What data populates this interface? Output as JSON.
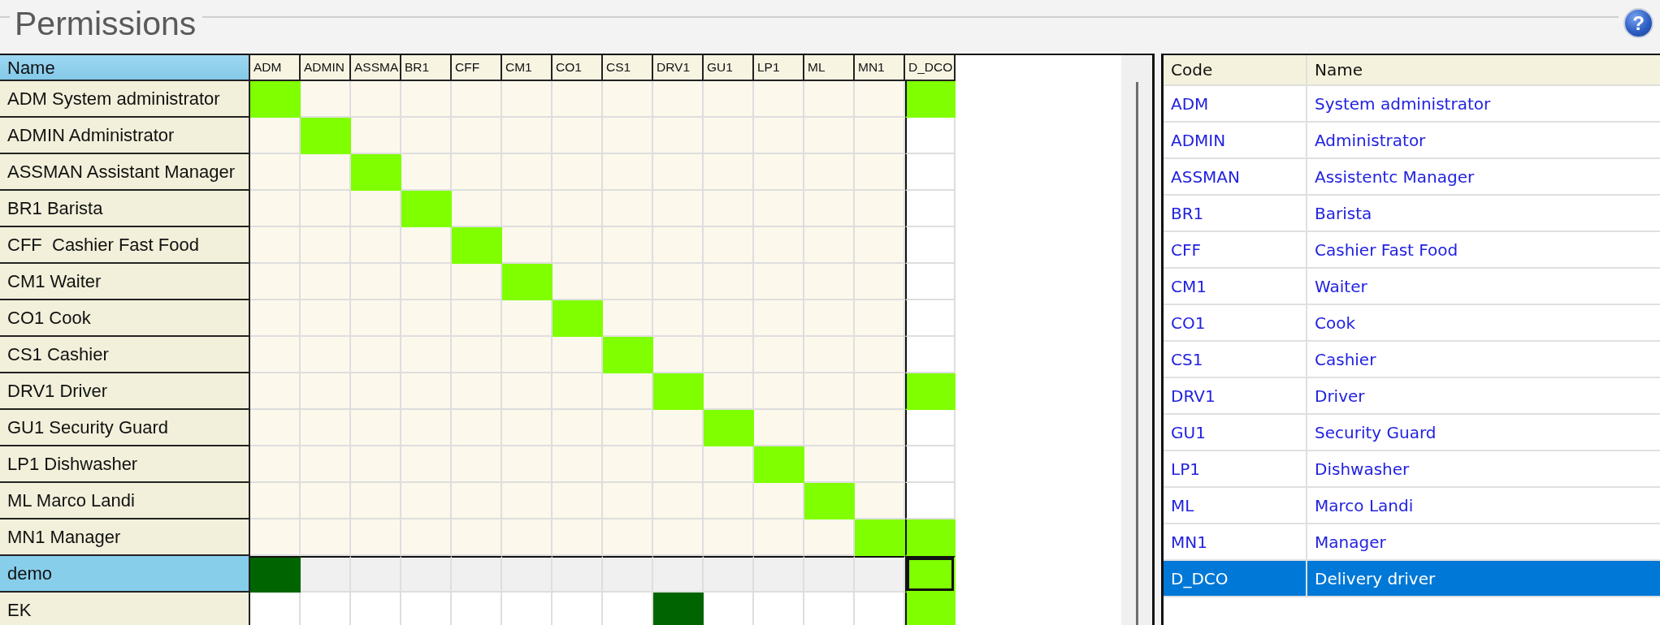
{
  "title": "Permissions",
  "help_button": {
    "label": "?"
  },
  "matrix": {
    "name_header": "Name",
    "columns": [
      {
        "label": "ADM",
        "selected": false
      },
      {
        "label": "ADMIN",
        "selected": false
      },
      {
        "label": "ASSMA",
        "selected": false
      },
      {
        "label": "BR1",
        "selected": false
      },
      {
        "label": "CFF",
        "selected": false
      },
      {
        "label": "CM1",
        "selected": false
      },
      {
        "label": "CO1",
        "selected": false
      },
      {
        "label": "CS1",
        "selected": false
      },
      {
        "label": "DRV1",
        "selected": false
      },
      {
        "label": "GU1",
        "selected": false
      },
      {
        "label": "LP1",
        "selected": false
      },
      {
        "label": "ML",
        "selected": false
      },
      {
        "label": "MN1",
        "selected": false
      },
      {
        "label": "D_DCO",
        "selected": true
      }
    ],
    "rows": [
      {
        "label": "ADM System administrator",
        "kind": "role",
        "selected": false,
        "cells": [
          {
            "checked": true
          },
          {
            "checked": false
          },
          {
            "checked": false
          },
          {
            "checked": false
          },
          {
            "checked": false
          },
          {
            "checked": false
          },
          {
            "checked": false
          },
          {
            "checked": false
          },
          {
            "checked": false
          },
          {
            "checked": false
          },
          {
            "checked": false
          },
          {
            "checked": false
          },
          {
            "checked": false
          },
          {
            "checked": true
          }
        ]
      },
      {
        "label": "ADMIN Administrator",
        "kind": "role",
        "selected": false,
        "cells": [
          {
            "checked": false
          },
          {
            "checked": true
          },
          {
            "checked": false
          },
          {
            "checked": false
          },
          {
            "checked": false
          },
          {
            "checked": false
          },
          {
            "checked": false
          },
          {
            "checked": false
          },
          {
            "checked": false
          },
          {
            "checked": false
          },
          {
            "checked": false
          },
          {
            "checked": false
          },
          {
            "checked": false
          },
          {
            "checked": false
          }
        ]
      },
      {
        "label": "ASSMAN Assistant Manager",
        "kind": "role",
        "selected": false,
        "cells": [
          {
            "checked": false
          },
          {
            "checked": false
          },
          {
            "checked": true
          },
          {
            "checked": false
          },
          {
            "checked": false
          },
          {
            "checked": false
          },
          {
            "checked": false
          },
          {
            "checked": false
          },
          {
            "checked": false
          },
          {
            "checked": false
          },
          {
            "checked": false
          },
          {
            "checked": false
          },
          {
            "checked": false
          },
          {
            "checked": false
          }
        ]
      },
      {
        "label": "BR1 Barista",
        "kind": "role",
        "selected": false,
        "cells": [
          {
            "checked": false
          },
          {
            "checked": false
          },
          {
            "checked": false
          },
          {
            "checked": true
          },
          {
            "checked": false
          },
          {
            "checked": false
          },
          {
            "checked": false
          },
          {
            "checked": false
          },
          {
            "checked": false
          },
          {
            "checked": false
          },
          {
            "checked": false
          },
          {
            "checked": false
          },
          {
            "checked": false
          },
          {
            "checked": false
          }
        ]
      },
      {
        "label": "CFF  Cashier Fast Food",
        "kind": "role",
        "selected": false,
        "cells": [
          {
            "checked": false
          },
          {
            "checked": false
          },
          {
            "checked": false
          },
          {
            "checked": false
          },
          {
            "checked": true
          },
          {
            "checked": false
          },
          {
            "checked": false
          },
          {
            "checked": false
          },
          {
            "checked": false
          },
          {
            "checked": false
          },
          {
            "checked": false
          },
          {
            "checked": false
          },
          {
            "checked": false
          },
          {
            "checked": false
          }
        ]
      },
      {
        "label": "CM1 Waiter",
        "kind": "role",
        "selected": false,
        "cells": [
          {
            "checked": false
          },
          {
            "checked": false
          },
          {
            "checked": false
          },
          {
            "checked": false
          },
          {
            "checked": false
          },
          {
            "checked": true
          },
          {
            "checked": false
          },
          {
            "checked": false
          },
          {
            "checked": false
          },
          {
            "checked": false
          },
          {
            "checked": false
          },
          {
            "checked": false
          },
          {
            "checked": false
          },
          {
            "checked": false
          }
        ]
      },
      {
        "label": "CO1 Cook",
        "kind": "role",
        "selected": false,
        "cells": [
          {
            "checked": false
          },
          {
            "checked": false
          },
          {
            "checked": false
          },
          {
            "checked": false
          },
          {
            "checked": false
          },
          {
            "checked": false
          },
          {
            "checked": true
          },
          {
            "checked": false
          },
          {
            "checked": false
          },
          {
            "checked": false
          },
          {
            "checked": false
          },
          {
            "checked": false
          },
          {
            "checked": false
          },
          {
            "checked": false
          }
        ]
      },
      {
        "label": "CS1 Cashier",
        "kind": "role",
        "selected": false,
        "cells": [
          {
            "checked": false
          },
          {
            "checked": false
          },
          {
            "checked": false
          },
          {
            "checked": false
          },
          {
            "checked": false
          },
          {
            "checked": false
          },
          {
            "checked": false
          },
          {
            "checked": true
          },
          {
            "checked": false
          },
          {
            "checked": false
          },
          {
            "checked": false
          },
          {
            "checked": false
          },
          {
            "checked": false
          },
          {
            "checked": false
          }
        ]
      },
      {
        "label": "DRV1 Driver",
        "kind": "role",
        "selected": false,
        "cells": [
          {
            "checked": false
          },
          {
            "checked": false
          },
          {
            "checked": false
          },
          {
            "checked": false
          },
          {
            "checked": false
          },
          {
            "checked": false
          },
          {
            "checked": false
          },
          {
            "checked": false
          },
          {
            "checked": true
          },
          {
            "checked": false
          },
          {
            "checked": false
          },
          {
            "checked": false
          },
          {
            "checked": false
          },
          {
            "checked": true
          }
        ]
      },
      {
        "label": "GU1 Security Guard",
        "kind": "role",
        "selected": false,
        "cells": [
          {
            "checked": false
          },
          {
            "checked": false
          },
          {
            "checked": false
          },
          {
            "checked": false
          },
          {
            "checked": false
          },
          {
            "checked": false
          },
          {
            "checked": false
          },
          {
            "checked": false
          },
          {
            "checked": false
          },
          {
            "checked": true
          },
          {
            "checked": false
          },
          {
            "checked": false
          },
          {
            "checked": false
          },
          {
            "checked": false
          }
        ]
      },
      {
        "label": "LP1 Dishwasher",
        "kind": "role",
        "selected": false,
        "cells": [
          {
            "checked": false
          },
          {
            "checked": false
          },
          {
            "checked": false
          },
          {
            "checked": false
          },
          {
            "checked": false
          },
          {
            "checked": false
          },
          {
            "checked": false
          },
          {
            "checked": false
          },
          {
            "checked": false
          },
          {
            "checked": false
          },
          {
            "checked": true
          },
          {
            "checked": false
          },
          {
            "checked": false
          },
          {
            "checked": false
          }
        ]
      },
      {
        "label": "ML Marco Landi",
        "kind": "role",
        "selected": false,
        "cells": [
          {
            "checked": false
          },
          {
            "checked": false
          },
          {
            "checked": false
          },
          {
            "checked": false
          },
          {
            "checked": false
          },
          {
            "checked": false
          },
          {
            "checked": false
          },
          {
            "checked": false
          },
          {
            "checked": false
          },
          {
            "checked": false
          },
          {
            "checked": false
          },
          {
            "checked": true
          },
          {
            "checked": false
          },
          {
            "checked": false
          }
        ]
      },
      {
        "label": "MN1 Manager",
        "kind": "role",
        "selected": false,
        "cells": [
          {
            "checked": false
          },
          {
            "checked": false
          },
          {
            "checked": false
          },
          {
            "checked": false
          },
          {
            "checked": false
          },
          {
            "checked": false
          },
          {
            "checked": false
          },
          {
            "checked": false
          },
          {
            "checked": false
          },
          {
            "checked": false
          },
          {
            "checked": false
          },
          {
            "checked": false
          },
          {
            "checked": true
          },
          {
            "checked": true
          }
        ]
      },
      {
        "label": "demo",
        "kind": "user",
        "selected": true,
        "cells": [
          {
            "checked": true
          },
          {
            "checked": false
          },
          {
            "checked": false
          },
          {
            "checked": false
          },
          {
            "checked": false
          },
          {
            "checked": false
          },
          {
            "checked": false
          },
          {
            "checked": false
          },
          {
            "checked": false
          },
          {
            "checked": false
          },
          {
            "checked": false
          },
          {
            "checked": false
          },
          {
            "checked": false
          },
          {
            "checked": true
          }
        ]
      },
      {
        "label": "EK",
        "kind": "user",
        "selected": false,
        "cells": [
          {
            "checked": false
          },
          {
            "checked": false
          },
          {
            "checked": false
          },
          {
            "checked": false
          },
          {
            "checked": false
          },
          {
            "checked": false
          },
          {
            "checked": false
          },
          {
            "checked": false
          },
          {
            "checked": true
          },
          {
            "checked": false
          },
          {
            "checked": false
          },
          {
            "checked": false
          },
          {
            "checked": false
          },
          {
            "checked": true
          }
        ]
      }
    ]
  },
  "roles": {
    "columns": [
      "Code",
      "Name"
    ],
    "rows": [
      {
        "code": "ADM",
        "name": "System administrator",
        "selected": false
      },
      {
        "code": "ADMIN",
        "name": "Administrator",
        "selected": false
      },
      {
        "code": "ASSMAN",
        "name": "Assistentc Manager",
        "selected": false
      },
      {
        "code": "BR1",
        "name": "Barista",
        "selected": false
      },
      {
        "code": "CFF",
        "name": "Cashier Fast Food",
        "selected": false
      },
      {
        "code": "CM1",
        "name": "Waiter",
        "selected": false
      },
      {
        "code": "CO1",
        "name": "Cook",
        "selected": false
      },
      {
        "code": "CS1",
        "name": "Cashier",
        "selected": false
      },
      {
        "code": "DRV1",
        "name": "Driver",
        "selected": false
      },
      {
        "code": "GU1",
        "name": "Security Guard",
        "selected": false
      },
      {
        "code": "LP1",
        "name": "Dishwasher",
        "selected": false
      },
      {
        "code": "ML",
        "name": "Marco Landi",
        "selected": false
      },
      {
        "code": "MN1",
        "name": "Manager",
        "selected": false
      },
      {
        "code": "D_DCO",
        "name": "Delivery driver",
        "selected": true
      }
    ]
  }
}
